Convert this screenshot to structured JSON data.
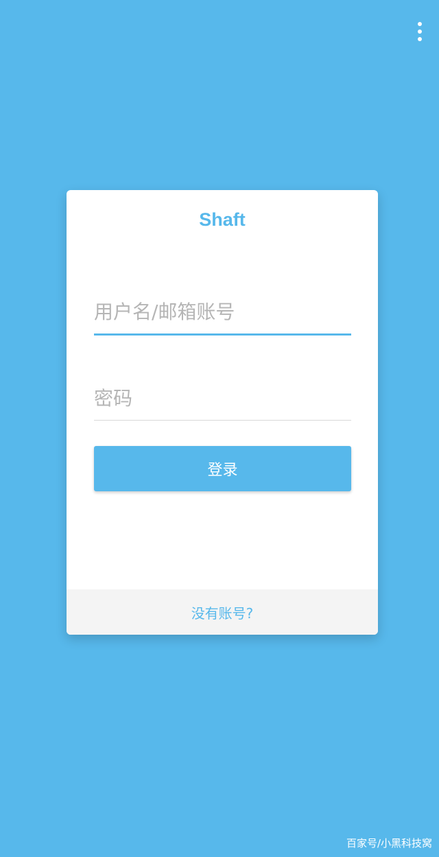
{
  "menu": {
    "icon": "more-vert-icon"
  },
  "login_card": {
    "app_title": "Shaft",
    "username_placeholder": "用户名/邮箱账号",
    "username_value": "",
    "password_placeholder": "密码",
    "password_value": "",
    "login_button_label": "登录",
    "register_link_label": "没有账号?"
  },
  "watermark": {
    "text": "百家号/小黑科技窝"
  },
  "colors": {
    "background": "#57b8eb",
    "accent": "#57b8eb",
    "card": "#ffffff",
    "footer": "#f4f4f4"
  }
}
